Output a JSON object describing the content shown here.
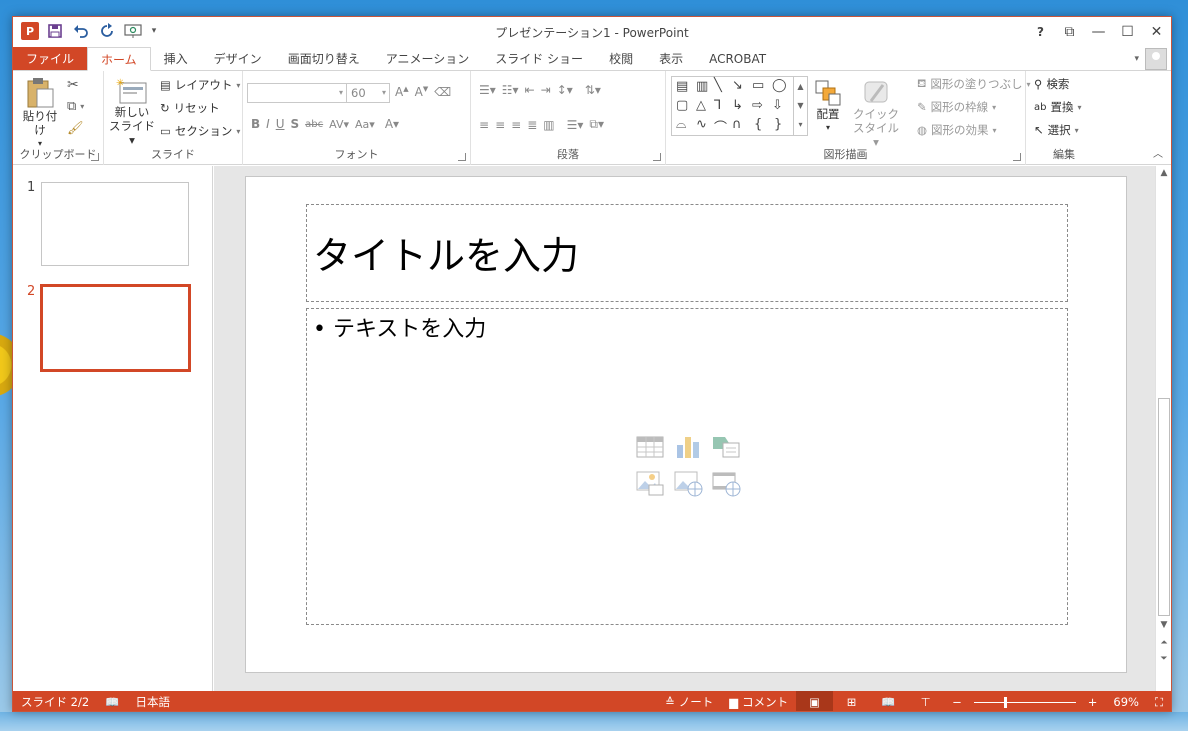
{
  "window": {
    "title": "プレゼンテーション1 - PowerPoint"
  },
  "qat": {
    "app_icon": "P",
    "icons": [
      "save-icon",
      "undo-icon",
      "redo-icon",
      "present-icon"
    ]
  },
  "controls": {
    "help": "?",
    "restore_ribbon": "⧉",
    "minimize": "—",
    "maximize": "☐",
    "close": "✕"
  },
  "tabs": [
    "ファイル",
    "ホーム",
    "挿入",
    "デザイン",
    "画面切り替え",
    "アニメーション",
    "スライド ショー",
    "校閲",
    "表示",
    "ACROBAT"
  ],
  "active_tab": "ホーム",
  "ribbon": {
    "clipboard": {
      "label": "クリップボード",
      "paste": "貼り付け"
    },
    "slides": {
      "label": "スライド",
      "new_slide_line1": "新しい",
      "new_slide_line2": "スライド",
      "layout": "レイアウト",
      "reset": "リセット",
      "section": "セクション"
    },
    "font": {
      "label": "フォント",
      "font_name": "",
      "font_size": "60"
    },
    "paragraph": {
      "label": "段落"
    },
    "drawing": {
      "label": "図形描画",
      "arrange": "配置",
      "quick_styles_line1": "クイック",
      "quick_styles_line2": "スタイル",
      "shape_fill": "図形の塗りつぶし",
      "shape_outline": "図形の枠線",
      "shape_effects": "図形の効果"
    },
    "editing": {
      "label": "編集",
      "find": "検索",
      "replace": "置換",
      "select": "選択"
    }
  },
  "slides": [
    {
      "number": "1"
    },
    {
      "number": "2"
    }
  ],
  "selected_slide": "2",
  "slide": {
    "title_placeholder": "タイトルを入力",
    "body_placeholder": "• テキストを入力"
  },
  "status": {
    "slide_info": "スライド 2/2",
    "language": "日本語",
    "notes": "ノート",
    "comments": "コメント",
    "zoom": "69%"
  },
  "colors": {
    "accent": "#d24726"
  }
}
